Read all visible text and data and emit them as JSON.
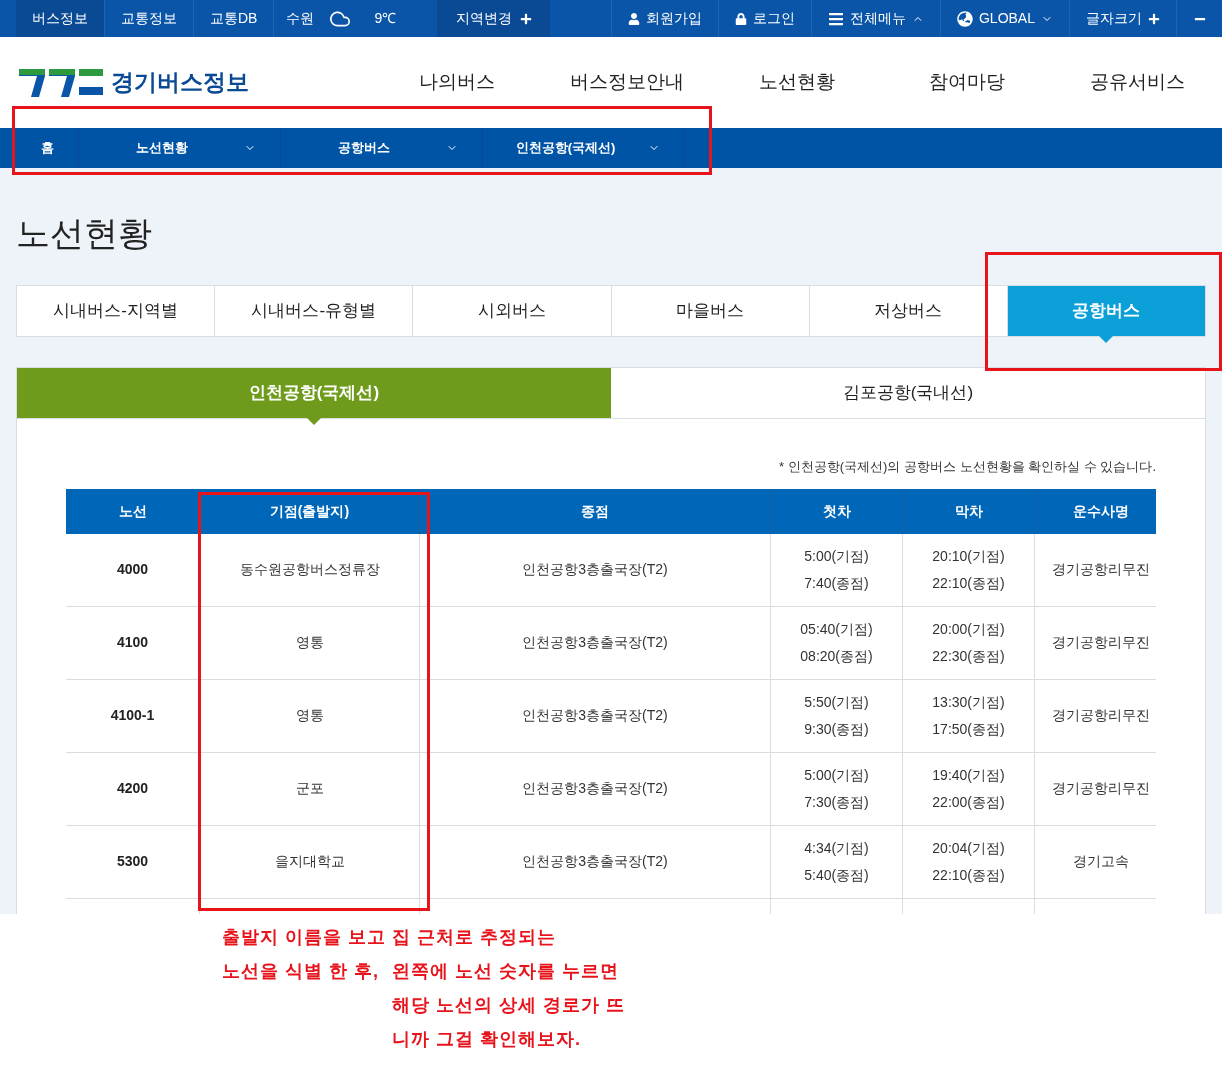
{
  "top_bar": {
    "left": [
      {
        "label": "버스정보",
        "selected": true
      },
      {
        "label": "교통정보",
        "selected": false
      },
      {
        "label": "교통DB",
        "selected": false
      }
    ],
    "region": "수원",
    "temperature": "9℃",
    "region_change": "지역변경",
    "right": [
      {
        "label": "회원가입",
        "kind": "user"
      },
      {
        "label": "로그인",
        "kind": "lock"
      },
      {
        "label": "전체메뉴",
        "kind": "menu"
      },
      {
        "label": "GLOBAL",
        "kind": "globe"
      },
      {
        "label": "글자크기",
        "kind": "plus"
      }
    ]
  },
  "header": {
    "logo_text": "경기버스정보",
    "nav": [
      "나의버스",
      "버스정보안내",
      "노선현황",
      "참여마당",
      "공유서비스"
    ]
  },
  "breadcrumb": {
    "home": "홈",
    "items": [
      "노선현황",
      "공항버스",
      "인천공항(국제선)"
    ]
  },
  "page_title": "노선현황",
  "tabs": [
    {
      "label": "시내버스-지역별",
      "selected": false
    },
    {
      "label": "시내버스-유형별",
      "selected": false
    },
    {
      "label": "시외버스",
      "selected": false
    },
    {
      "label": "마을버스",
      "selected": false
    },
    {
      "label": "저상버스",
      "selected": false
    },
    {
      "label": "공항버스",
      "selected": true
    }
  ],
  "sub_tabs": [
    {
      "label": "인천공항(국제선)",
      "selected": true
    },
    {
      "label": "김포공항(국내선)",
      "selected": false
    }
  ],
  "note": "* 인천공항(국제선)의 공항버스 노선현황을 확인하실 수 있습니다.",
  "table": {
    "columns": [
      "노선",
      "기점(출발지)",
      "종점",
      "첫차",
      "막차",
      "운수사명"
    ],
    "rows": [
      {
        "route": "4000",
        "start": "동수원공항버스정류장",
        "end": "인천공항3층출국장(T2)",
        "first": [
          "5:00(기점)",
          "7:40(종점)"
        ],
        "last": [
          "20:10(기점)",
          "22:10(종점)"
        ],
        "company": "경기공항리무진"
      },
      {
        "route": "4100",
        "start": "영통",
        "end": "인천공항3층출국장(T2)",
        "first": [
          "05:40(기점)",
          "08:20(종점)"
        ],
        "last": [
          "20:00(기점)",
          "22:30(종점)"
        ],
        "company": "경기공항리무진"
      },
      {
        "route": "4100-1",
        "start": "영통",
        "end": "인천공항3층출국장(T2)",
        "first": [
          "5:50(기점)",
          "9:30(종점)"
        ],
        "last": [
          "13:30(기점)",
          "17:50(종점)"
        ],
        "company": "경기공항리무진"
      },
      {
        "route": "4200",
        "start": "군포",
        "end": "인천공항3층출국장(T2)",
        "first": [
          "5:00(기점)",
          "7:30(종점)"
        ],
        "last": [
          "19:40(기점)",
          "22:00(종점)"
        ],
        "company": "경기공항리무진"
      },
      {
        "route": "5300",
        "start": "을지대학교",
        "end": "인천공항3층출국장(T2)",
        "first": [
          "4:34(기점)",
          "5:40(종점)"
        ],
        "last": [
          "20:04(기점)",
          "22:10(종점)"
        ],
        "company": "경기고속"
      }
    ]
  },
  "annotation": {
    "line_1": "출발지 이름을 보고 집 근처로 추정되는",
    "line_2_left": "노선을 식별 한 후,",
    "line_2_right": "왼쪽에 노선 숫자를 누르면",
    "line_3": "해당 노선의 상세 경로가 뜨",
    "line_4": "니까 그걸 확인해보자."
  }
}
